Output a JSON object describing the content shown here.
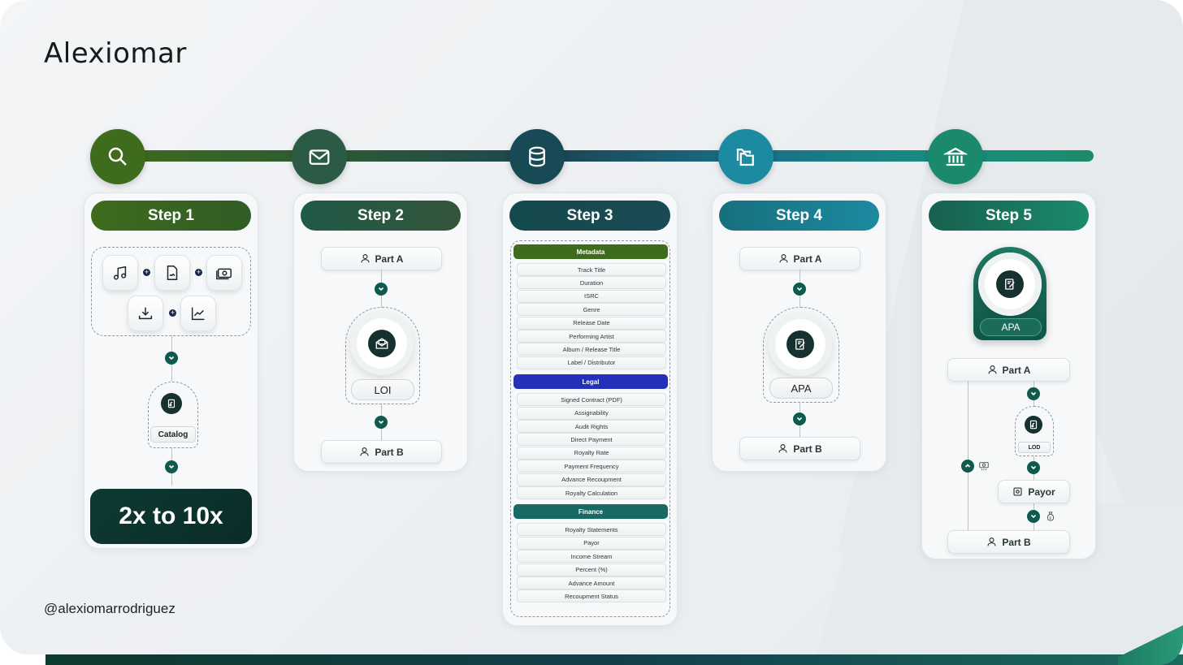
{
  "brand": "Alexiomar",
  "handle": "@alexiomarrodriguez",
  "colors": {
    "step1": "#3f6b1d",
    "step2": "#2b5b45",
    "step3": "#174a55",
    "step4": "#1c8aa0",
    "step5": "#1b8a6c",
    "metadata": "#3f6b1d",
    "legal": "#2330b8",
    "finance": "#176a63"
  },
  "timeline": {
    "nodes": [
      {
        "icon": "search-icon"
      },
      {
        "icon": "mail-icon"
      },
      {
        "icon": "database-icon"
      },
      {
        "icon": "folders-icon"
      },
      {
        "icon": "bank-icon"
      }
    ]
  },
  "step1": {
    "title": "Step 1",
    "icons": [
      "music-note-icon",
      "document-icon",
      "cash-icon",
      "download-icon",
      "trend-chart-icon"
    ],
    "catalog_label": "Catalog",
    "result": "2x to 10x"
  },
  "step2": {
    "title": "Step 2",
    "part_a": "Part A",
    "loi_label": "LOI",
    "part_b": "Part B"
  },
  "step3": {
    "title": "Step 3",
    "metadata_title": "Metadata",
    "metadata_fields": [
      "Track Title",
      "Duration",
      "ISRC",
      "Genre",
      "Release Date",
      "Performing Artist",
      "Album / Release Title",
      "Label / Distributor"
    ],
    "legal_title": "Legal",
    "legal_fields": [
      "Signed Contract (PDF)",
      "Assignability",
      "Audit Rights",
      "Direct Payment",
      "Royalty Rate",
      "Payment Frequency",
      "Advance Recoupment",
      "Royalty Calculation"
    ],
    "finance_title": "Finance",
    "finance_fields": [
      "Royalty Statements",
      "Payor",
      "Income Stream",
      "Percent (%)",
      "Advance Amount",
      "Recoupment Status"
    ]
  },
  "step4": {
    "title": "Step 4",
    "part_a": "Part A",
    "apa_label": "APA",
    "part_b": "Part B"
  },
  "step5": {
    "title": "Step 5",
    "apa_label": "APA",
    "part_a": "Part A",
    "lod_label": "LOD",
    "payor_label": "Payor",
    "part_b": "Part B"
  }
}
